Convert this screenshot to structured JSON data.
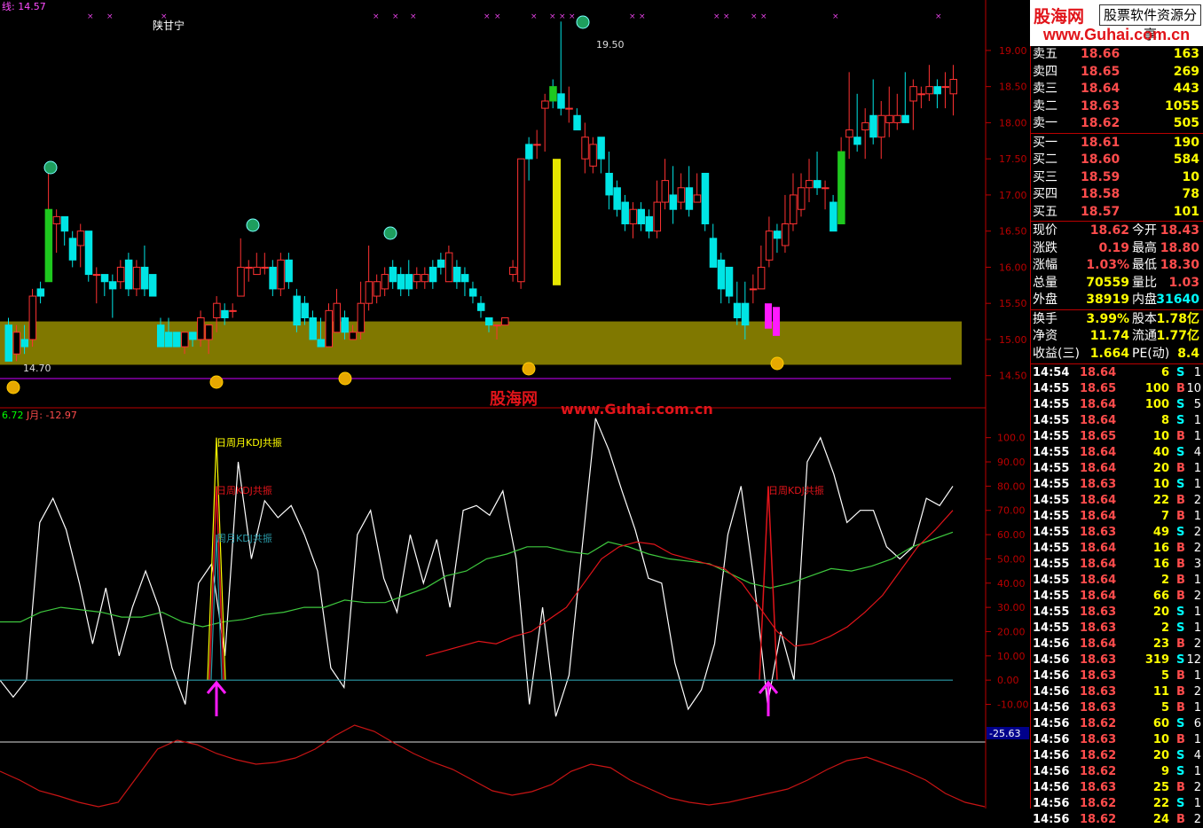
{
  "main_chart": {
    "ma_label": "线: 14.57",
    "stock_name": "陕甘宁",
    "high_label": "19.50",
    "low_label": "14.70",
    "price_axis": [
      "19.00",
      "18.50",
      "18.00",
      "17.50",
      "17.00",
      "16.50",
      "16.00",
      "15.50",
      "15.00",
      "14.50"
    ],
    "watermark_cn": "股海网",
    "watermark_url": "www.Guhai.com.cn"
  },
  "indicator": {
    "header_left": "6.72",
    "header_j": "J月: -12.97",
    "label_day_week_month": "日周月KDJ共振",
    "label_day_week": "日周KDJ共振",
    "label_week_month": "周月KDJ共振",
    "label_day_week_2": "日周KDJ共振",
    "axis": [
      "100.0",
      "90.00",
      "80.00",
      "70.00",
      "60.00",
      "50.00",
      "40.00",
      "30.00",
      "20.00",
      "10.00",
      "0.00",
      "-10.00"
    ],
    "current_value": "-25.63"
  },
  "chart_data": {
    "type": "candlestick",
    "price_ylim": [
      14.3,
      19.6
    ],
    "candles": [
      [
        15.2,
        14.7,
        15.3,
        14.7
      ],
      [
        14.8,
        15.1,
        15.2,
        14.7
      ],
      [
        15.0,
        14.9,
        15.2,
        14.8
      ],
      [
        15.0,
        15.6,
        15.7,
        14.9
      ],
      [
        15.7,
        15.6,
        15.8,
        15.5
      ],
      [
        15.8,
        16.8,
        17.3,
        15.8
      ],
      [
        16.6,
        16.7,
        16.8,
        16.2
      ],
      [
        16.7,
        16.5,
        16.7,
        16.3
      ],
      [
        16.4,
        16.1,
        16.5,
        16.0
      ],
      [
        16.3,
        16.5,
        16.6,
        16.0
      ],
      [
        16.5,
        15.9,
        16.5,
        15.8
      ],
      [
        15.9,
        15.9,
        16.0,
        15.5
      ],
      [
        15.9,
        15.8,
        15.9,
        15.6
      ],
      [
        15.8,
        15.7,
        15.9,
        15.3
      ],
      [
        15.8,
        16.0,
        16.1,
        15.7
      ],
      [
        16.1,
        15.7,
        16.2,
        15.6
      ],
      [
        15.7,
        16.0,
        16.1,
        15.6
      ],
      [
        16.0,
        15.7,
        16.3,
        15.6
      ],
      [
        15.9,
        15.6,
        15.9,
        15.6
      ],
      [
        15.2,
        14.9,
        15.3,
        14.9
      ],
      [
        15.1,
        14.9,
        15.3,
        14.9
      ],
      [
        15.1,
        14.9,
        15.1,
        14.9
      ],
      [
        14.9,
        15.1,
        15.1,
        14.8
      ],
      [
        15.1,
        15.0,
        15.1,
        14.9
      ],
      [
        15.0,
        15.3,
        15.4,
        14.9
      ],
      [
        15.0,
        15.2,
        15.2,
        14.8
      ],
      [
        15.3,
        15.5,
        15.6,
        15.1
      ],
      [
        15.4,
        15.3,
        15.5,
        15.2
      ],
      [
        15.4,
        15.4,
        15.5,
        15.3
      ],
      [
        15.6,
        16.0,
        16.4,
        15.6
      ],
      [
        16.0,
        16.0,
        16.1,
        15.8
      ],
      [
        15.9,
        16.0,
        16.2,
        15.9
      ],
      [
        16.0,
        16.0,
        16.2,
        15.9
      ],
      [
        16.0,
        15.7,
        16.1,
        15.6
      ],
      [
        15.7,
        16.1,
        16.2,
        15.6
      ],
      [
        16.1,
        15.8,
        16.2,
        15.7
      ],
      [
        15.6,
        15.2,
        15.7,
        15.1
      ],
      [
        15.5,
        15.3,
        15.6,
        15.2
      ],
      [
        15.3,
        15.0,
        15.4,
        15.0
      ],
      [
        15.0,
        14.9,
        15.3,
        14.9
      ],
      [
        14.9,
        15.4,
        15.5,
        14.9
      ],
      [
        15.1,
        15.5,
        15.7,
        15.1
      ],
      [
        15.3,
        15.1,
        15.4,
        15.0
      ],
      [
        15.0,
        15.1,
        15.2,
        15.0
      ],
      [
        15.1,
        15.5,
        15.8,
        15.0
      ],
      [
        15.5,
        15.8,
        16.3,
        15.4
      ],
      [
        15.6,
        15.8,
        15.9,
        15.5
      ],
      [
        15.7,
        15.9,
        16.0,
        15.6
      ],
      [
        16.0,
        15.8,
        16.1,
        15.7
      ],
      [
        15.9,
        15.7,
        16.0,
        15.6
      ],
      [
        15.9,
        15.7,
        16.1,
        15.6
      ],
      [
        15.8,
        15.9,
        16.0,
        15.7
      ],
      [
        15.8,
        15.9,
        16.0,
        15.7
      ],
      [
        16.0,
        15.8,
        16.1,
        15.7
      ],
      [
        16.1,
        16.0,
        16.2,
        15.9
      ],
      [
        15.8,
        16.2,
        16.3,
        15.8
      ],
      [
        16.0,
        15.8,
        16.1,
        15.7
      ],
      [
        15.9,
        15.8,
        16.0,
        15.6
      ],
      [
        15.7,
        15.6,
        15.8,
        15.5
      ],
      [
        15.5,
        15.4,
        15.6,
        15.3
      ],
      [
        15.3,
        15.2,
        15.3,
        15.1
      ],
      [
        15.2,
        15.2,
        15.2,
        15.0
      ],
      [
        15.2,
        15.3,
        15.3,
        15.2
      ],
      [
        15.9,
        16.0,
        16.1,
        15.8
      ],
      [
        15.8,
        17.5,
        17.5,
        15.7
      ],
      [
        17.7,
        17.5,
        17.8,
        17.2
      ],
      [
        17.7,
        17.7,
        17.9,
        17.5
      ],
      [
        18.2,
        18.3,
        18.4,
        17.6
      ],
      [
        18.5,
        18.3,
        18.6,
        18.2
      ],
      [
        18.4,
        18.2,
        19.4,
        18.1
      ],
      [
        18.2,
        18.2,
        18.5,
        18.0
      ],
      [
        18.1,
        17.9,
        18.2,
        17.9
      ],
      [
        17.5,
        17.8,
        18.0,
        17.3
      ],
      [
        17.4,
        17.7,
        17.8,
        17.3
      ],
      [
        17.8,
        17.5,
        17.7,
        17.3
      ],
      [
        17.3,
        17.0,
        17.6,
        16.8
      ],
      [
        17.1,
        16.8,
        17.2,
        16.7
      ],
      [
        16.9,
        16.6,
        17.0,
        16.5
      ],
      [
        16.6,
        16.8,
        16.9,
        16.4
      ],
      [
        16.8,
        16.6,
        16.9,
        16.5
      ],
      [
        16.7,
        16.5,
        16.8,
        16.4
      ],
      [
        16.5,
        16.9,
        17.2,
        16.4
      ],
      [
        16.9,
        17.2,
        17.5,
        16.8
      ],
      [
        17.0,
        16.8,
        17.4,
        16.6
      ],
      [
        16.9,
        17.1,
        17.3,
        16.8
      ],
      [
        17.1,
        16.8,
        17.4,
        16.7
      ],
      [
        16.9,
        17.0,
        17.3,
        16.9
      ],
      [
        17.3,
        16.6,
        17.3,
        16.5
      ],
      [
        16.4,
        16.0,
        16.6,
        16.0
      ],
      [
        16.1,
        15.7,
        16.2,
        15.5
      ],
      [
        16.0,
        15.6,
        16.0,
        15.5
      ],
      [
        15.5,
        15.3,
        15.8,
        15.2
      ],
      [
        15.5,
        15.2,
        15.8,
        15.0
      ],
      [
        15.7,
        15.7,
        15.9,
        15.5
      ],
      [
        15.7,
        16.0,
        16.3,
        15.7
      ],
      [
        16.1,
        16.5,
        16.7,
        16.0
      ],
      [
        16.5,
        16.4,
        16.6,
        16.2
      ],
      [
        16.3,
        16.6,
        17.0,
        16.2
      ],
      [
        16.6,
        17.0,
        17.3,
        16.5
      ],
      [
        16.8,
        17.1,
        17.3,
        16.7
      ],
      [
        17.1,
        17.2,
        17.5,
        16.9
      ],
      [
        17.2,
        17.1,
        17.6,
        17.0
      ],
      [
        17.1,
        17.1,
        17.2,
        16.8
      ],
      [
        16.9,
        16.5,
        17.0,
        16.5
      ],
      [
        16.6,
        17.6,
        17.8,
        16.6
      ],
      [
        17.8,
        17.9,
        18.7,
        17.5
      ],
      [
        17.8,
        17.7,
        18.4,
        17.6
      ],
      [
        17.9,
        18.0,
        18.2,
        17.5
      ],
      [
        18.1,
        17.8,
        18.6,
        17.7
      ],
      [
        17.8,
        18.1,
        18.3,
        17.5
      ],
      [
        18.0,
        18.1,
        18.5,
        17.8
      ],
      [
        18.0,
        18.1,
        18.4,
        17.9
      ],
      [
        18.1,
        18.0,
        18.7,
        18.1
      ],
      [
        18.3,
        18.5,
        18.6,
        17.9
      ],
      [
        18.4,
        18.4,
        18.5,
        18.2
      ],
      [
        18.4,
        18.5,
        18.8,
        18.3
      ],
      [
        18.5,
        18.4,
        18.6,
        18.2
      ],
      [
        18.5,
        18.5,
        18.7,
        18.2
      ],
      [
        18.4,
        18.6,
        18.8,
        18.1
      ]
    ],
    "support_band": [
      14.65,
      15.25
    ],
    "kdj_ylim": [
      -30,
      105
    ]
  },
  "quotes": {
    "sell": [
      {
        "label": "卖五",
        "price": "18.66",
        "vol": "163"
      },
      {
        "label": "卖四",
        "price": "18.65",
        "vol": "269"
      },
      {
        "label": "卖三",
        "price": "18.64",
        "vol": "443"
      },
      {
        "label": "卖二",
        "price": "18.63",
        "vol": "1055"
      },
      {
        "label": "卖一",
        "price": "18.62",
        "vol": "505"
      }
    ],
    "buy": [
      {
        "label": "买一",
        "price": "18.61",
        "vol": "190"
      },
      {
        "label": "买二",
        "price": "18.60",
        "vol": "584"
      },
      {
        "label": "买三",
        "price": "18.59",
        "vol": "10"
      },
      {
        "label": "买四",
        "price": "18.58",
        "vol": "78"
      },
      {
        "label": "买五",
        "price": "18.57",
        "vol": "101"
      }
    ]
  },
  "stats": [
    {
      "l1": "现价",
      "v1": "18.62",
      "l2": "今开",
      "v2": "18.43"
    },
    {
      "l1": "涨跌",
      "v1": "0.19",
      "l2": "最高",
      "v2": "18.80"
    },
    {
      "l1": "涨幅",
      "v1": "1.03%",
      "l2": "最低",
      "v2": "18.30"
    },
    {
      "l1": "总量",
      "v1": "70559",
      "l2": "量比",
      "v2": "1.03"
    },
    {
      "l1": "外盘",
      "v1": "38919",
      "l2": "内盘",
      "v2": "31640"
    },
    {
      "l1": "换手",
      "v1": "3.99%",
      "l2": "股本",
      "v2": "1.78亿"
    },
    {
      "l1": "净资",
      "v1": "11.74",
      "l2": "流通",
      "v2": "1.77亿"
    },
    {
      "l1": "收益(三)",
      "v1": "1.664",
      "l2": "PE(动)",
      "v2": "8.4"
    }
  ],
  "ticks": [
    [
      "14:54",
      "18.64",
      "6",
      "S",
      "1"
    ],
    [
      "14:55",
      "18.65",
      "100",
      "B",
      "10"
    ],
    [
      "14:55",
      "18.64",
      "100",
      "S",
      "5"
    ],
    [
      "14:55",
      "18.64",
      "8",
      "S",
      "1"
    ],
    [
      "14:55",
      "18.65",
      "10",
      "B",
      "1"
    ],
    [
      "14:55",
      "18.64",
      "40",
      "S",
      "4"
    ],
    [
      "14:55",
      "18.64",
      "20",
      "B",
      "1"
    ],
    [
      "14:55",
      "18.63",
      "10",
      "S",
      "1"
    ],
    [
      "14:55",
      "18.64",
      "22",
      "B",
      "2"
    ],
    [
      "14:55",
      "18.64",
      "7",
      "B",
      "1"
    ],
    [
      "14:55",
      "18.63",
      "49",
      "S",
      "2"
    ],
    [
      "14:55",
      "18.64",
      "16",
      "B",
      "2"
    ],
    [
      "14:55",
      "18.64",
      "16",
      "B",
      "3"
    ],
    [
      "14:55",
      "18.64",
      "2",
      "B",
      "1"
    ],
    [
      "14:55",
      "18.64",
      "66",
      "B",
      "2"
    ],
    [
      "14:55",
      "18.63",
      "20",
      "S",
      "1"
    ],
    [
      "14:55",
      "18.63",
      "2",
      "S",
      "1"
    ],
    [
      "14:56",
      "18.64",
      "23",
      "B",
      "2"
    ],
    [
      "14:56",
      "18.63",
      "319",
      "S",
      "12"
    ],
    [
      "14:56",
      "18.63",
      "5",
      "B",
      "1"
    ],
    [
      "14:56",
      "18.63",
      "11",
      "B",
      "2"
    ],
    [
      "14:56",
      "18.63",
      "5",
      "B",
      "1"
    ],
    [
      "14:56",
      "18.62",
      "60",
      "S",
      "6"
    ],
    [
      "14:56",
      "18.63",
      "10",
      "B",
      "1"
    ],
    [
      "14:56",
      "18.62",
      "20",
      "S",
      "4"
    ],
    [
      "14:56",
      "18.62",
      "9",
      "S",
      "1"
    ],
    [
      "14:56",
      "18.63",
      "25",
      "B",
      "2"
    ],
    [
      "14:56",
      "18.62",
      "22",
      "S",
      "1"
    ],
    [
      "14:56",
      "18.62",
      "24",
      "B",
      "2"
    ]
  ],
  "logo": {
    "cn": "股海网",
    "slogan": "股票软件资源分享",
    "url": "www.Guhai.com.cn"
  }
}
